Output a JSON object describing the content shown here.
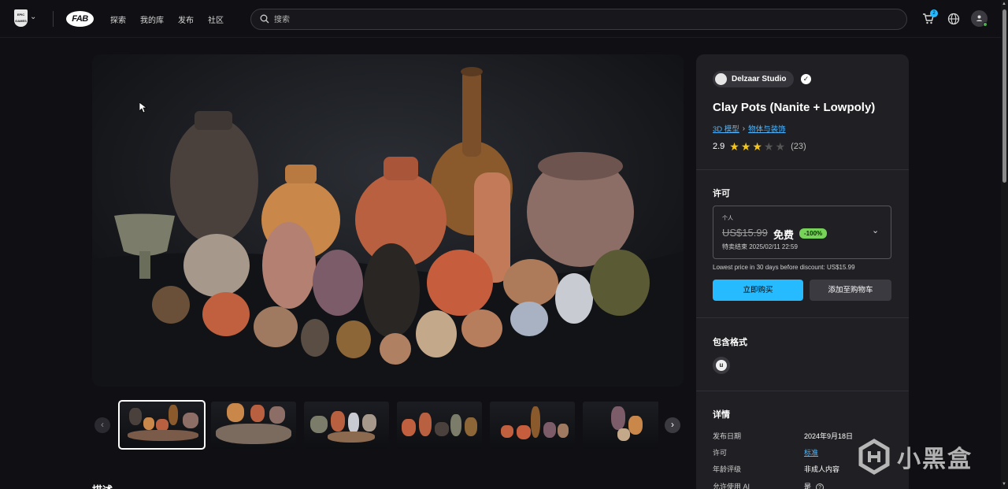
{
  "header": {
    "epic_logo": "EPIC GAMES",
    "fab_logo": "FAB",
    "nav": [
      "探索",
      "我的库",
      "发布",
      "社区"
    ],
    "search_placeholder": "搜索",
    "cart_count": "2",
    "icons": [
      "chevron-down-icon",
      "search-icon",
      "cart-icon",
      "globe-icon",
      "user-icon"
    ]
  },
  "gallery": {
    "prev": "‹",
    "next": "›",
    "thumbnail_count": 6,
    "active_index": 0
  },
  "description": {
    "title": "描述"
  },
  "product": {
    "seller": "Delzaar Studio",
    "title": "Clay Pots (Nanite + Lowpoly)",
    "breadcrumb": [
      "3D 模型",
      "物体与装饰"
    ],
    "rating": "2.9",
    "rating_stars": 2.9,
    "rating_count": "(23)"
  },
  "license": {
    "heading": "许可",
    "tier": "个人",
    "original_price": "US$15.99",
    "price": "免费",
    "discount": "-100%",
    "sale_ends": "特卖结束 2025/02/11 22:59",
    "lowest_price_note": "Lowest price in 30 days before discount: US$15.99",
    "buy_button": "立即购买",
    "add_to_cart_button": "添加至购物车"
  },
  "formats": {
    "heading": "包含格式",
    "items": [
      "Unreal Engine"
    ]
  },
  "details": {
    "heading": "详情",
    "rows": [
      {
        "label": "发布日期",
        "value": "2024年9月18日"
      },
      {
        "label": "许可",
        "value": "标准"
      },
      {
        "label": "年龄评级",
        "value": "非成人内容"
      },
      {
        "label": "允许使用 AI",
        "value": "是"
      }
    ]
  },
  "watermark": {
    "text": "小黑盒"
  },
  "colors": {
    "accent": "#26bbff",
    "discount": "#77d25a",
    "star": "#f5c518",
    "panel": "#202024",
    "background": "#101014"
  }
}
